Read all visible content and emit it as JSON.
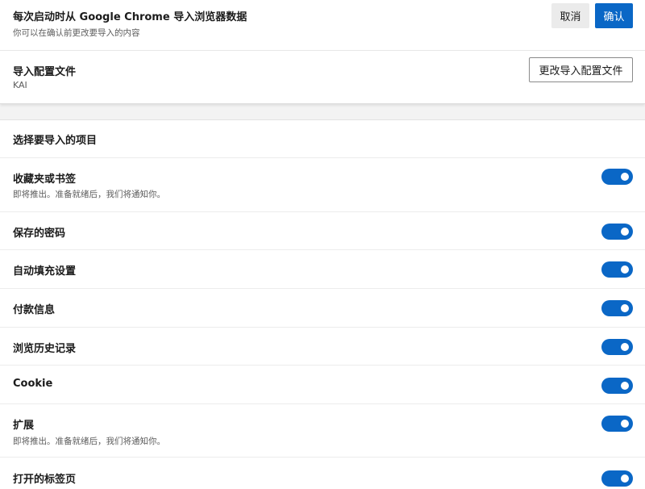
{
  "header": {
    "title": "每次启动时从 Google Chrome 导入浏览器数据",
    "subtitle": "你可以在确认前更改要导入的内容",
    "cancel_label": "取消",
    "confirm_label": "确认"
  },
  "profile": {
    "title": "导入配置文件",
    "value": "KAI",
    "change_label": "更改导入配置文件"
  },
  "items_section": {
    "heading": "选择要导入的项目",
    "items": [
      {
        "label": "收藏夹或书签",
        "note": "即将推出。准备就绪后，我们将通知你。",
        "enabled": true
      },
      {
        "label": "保存的密码",
        "note": "",
        "enabled": true
      },
      {
        "label": "自动填充设置",
        "note": "",
        "enabled": true
      },
      {
        "label": "付款信息",
        "note": "",
        "enabled": true
      },
      {
        "label": "浏览历史记录",
        "note": "",
        "enabled": true
      },
      {
        "label": "Cookie",
        "note": "",
        "enabled": true
      },
      {
        "label": "扩展",
        "note": "即将推出。准备就绪后，我们将通知你。",
        "enabled": true
      },
      {
        "label": "打开的标签页",
        "note": "",
        "enabled": true
      }
    ]
  },
  "colors": {
    "accent": "#0a67c6",
    "page_bg": "#f3f3f3"
  }
}
